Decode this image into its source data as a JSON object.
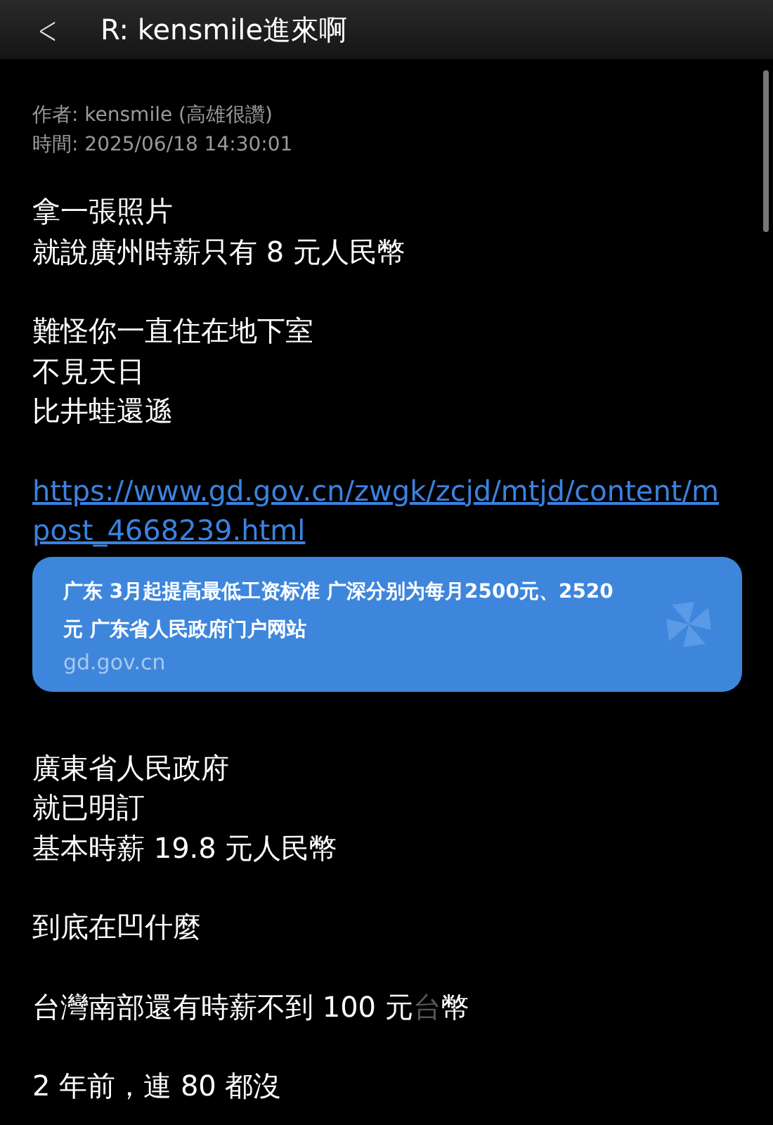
{
  "header": {
    "back": "<",
    "title": "R: kensmile進來啊"
  },
  "meta": {
    "author": "作者: kensmile (高雄很讚)",
    "time": "時間: 2025/06/18 14:30:01"
  },
  "blocks": [
    {
      "kind": "paragraph",
      "lines": [
        [
          {
            "text": "拿一張照片",
            "dimmed": false
          }
        ],
        [
          {
            "text": "就說廣州時薪只有 8 元人民幣",
            "dimmed": false
          }
        ]
      ]
    },
    {
      "kind": "paragraph",
      "lines": [
        [
          {
            "text": "難怪你一直住在地下室",
            "dimmed": false
          }
        ],
        [
          {
            "text": "不見天日",
            "dimmed": false
          }
        ],
        [
          {
            "text": "比井蛙還遜",
            "dimmed": false
          }
        ]
      ]
    },
    {
      "kind": "link",
      "text": "https://www.gd.gov.cn/zwgk/zcjd/mtjd/content/mpost_4668239.html"
    },
    {
      "kind": "preview",
      "title": "广东 3月起提高最低工资标准 广深分别为每月2500元、2520元  广东省人民政府门户网站",
      "domain": "gd.gov.cn"
    },
    {
      "kind": "paragraph",
      "lines": [
        [
          {
            "text": "廣東省人民政府",
            "dimmed": false
          }
        ],
        [
          {
            "text": "就已明訂",
            "dimmed": false
          }
        ],
        [
          {
            "text": "基本時薪 19.8 元人民幣",
            "dimmed": false
          }
        ]
      ]
    },
    {
      "kind": "paragraph",
      "lines": [
        [
          {
            "text": "到底在凹什麼",
            "dimmed": false
          }
        ]
      ]
    },
    {
      "kind": "paragraph",
      "lines": [
        [
          {
            "text": "台灣南部還有時薪不到 100 元",
            "dimmed": false
          },
          {
            "text": "台",
            "dimmed": true
          },
          {
            "text": "幣",
            "dimmed": false
          }
        ]
      ]
    },
    {
      "kind": "paragraph",
      "lines": [
        [
          {
            "text": "2 年前，連 80 都沒",
            "dimmed": false
          }
        ]
      ]
    }
  ]
}
